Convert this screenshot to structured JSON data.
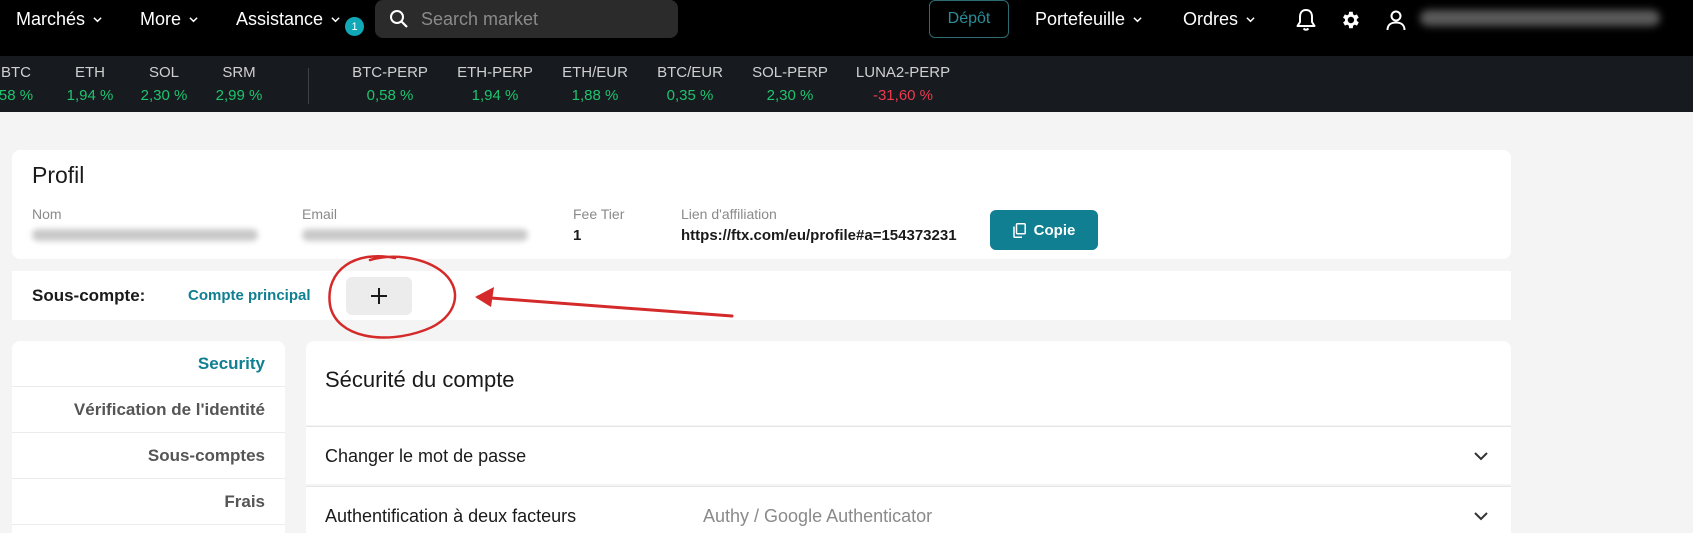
{
  "nav": {
    "markets": "Marchés",
    "more": "More",
    "assistance": "Assistance",
    "assistance_badge": "1",
    "search_placeholder": "Search market",
    "deposit": "Dépôt",
    "portfolio": "Portefeuille",
    "orders": "Ordres",
    "icons": [
      "bell-icon",
      "gear-icon",
      "user-icon"
    ]
  },
  "ticker": {
    "spot": [
      {
        "symbol": "BTC",
        "change": "58 %",
        "direction": "up"
      },
      {
        "symbol": "ETH",
        "change": "1,94 %",
        "direction": "up"
      },
      {
        "symbol": "SOL",
        "change": "2,30 %",
        "direction": "up"
      },
      {
        "symbol": "SRM",
        "change": "2,99 %",
        "direction": "up"
      }
    ],
    "perp": [
      {
        "symbol": "BTC-PERP",
        "change": "0,58 %",
        "direction": "up"
      },
      {
        "symbol": "ETH-PERP",
        "change": "1,94 %",
        "direction": "up"
      },
      {
        "symbol": "ETH/EUR",
        "change": "1,88 %",
        "direction": "up"
      },
      {
        "symbol": "BTC/EUR",
        "change": "0,35 %",
        "direction": "up"
      },
      {
        "symbol": "SOL-PERP",
        "change": "2,30 %",
        "direction": "up"
      },
      {
        "symbol": "LUNA2-PERP",
        "change": "-31,60 %",
        "direction": "down"
      }
    ]
  },
  "profile": {
    "title": "Profil",
    "name_label": "Nom",
    "email_label": "Email",
    "fee_tier_label": "Fee Tier",
    "fee_tier_value": "1",
    "affiliate_label": "Lien d'affiliation",
    "affiliate_value": "https://ftx.com/eu/profile#a=154373231",
    "copy_label": "Copie"
  },
  "subaccount": {
    "label": "Sous-compte:",
    "main": "Compte principal",
    "add_symbol": "+"
  },
  "menu": {
    "items": [
      "Security",
      "Vérification de l'identité",
      "Sous-comptes",
      "Frais"
    ]
  },
  "security": {
    "title": "Sécurité du compte",
    "rows": [
      {
        "label": "Changer le mot de passe",
        "value": ""
      },
      {
        "label": "Authentification à deux facteurs",
        "value": "Authy / Google Authenticator"
      }
    ]
  },
  "colors": {
    "accent": "#0f7f91",
    "up": "#1ec46e",
    "down": "#ee3a4e",
    "annotation": "#d42a2a"
  }
}
